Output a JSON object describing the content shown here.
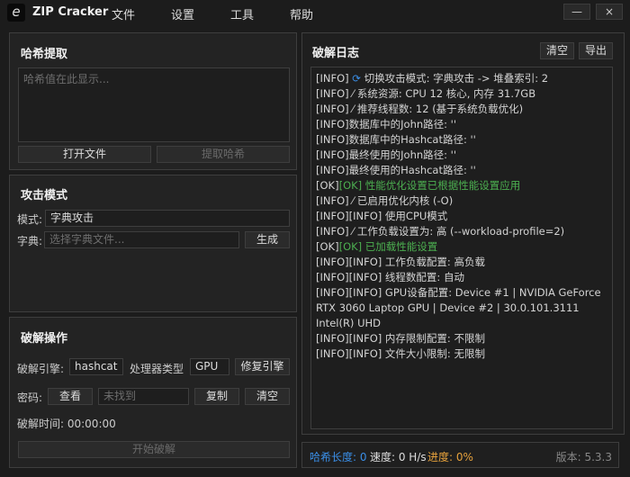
{
  "app": {
    "title": "ZIP Cracker",
    "logo": "e",
    "menu": [
      "文件",
      "设置",
      "工具",
      "帮助"
    ],
    "minimize": "—",
    "close": "×"
  },
  "hash": {
    "title": "哈希提取",
    "placeholder": "哈希值在此显示...",
    "open": "打开文件",
    "extract": "提取哈希"
  },
  "attack": {
    "title": "攻击模式",
    "mode_label": "模式:",
    "mode_value": "字典攻击",
    "dict_label": "字典:",
    "dict_placeholder": "选择字典文件...",
    "generate": "生成"
  },
  "crack": {
    "title": "破解操作",
    "engine_label": "破解引擎:",
    "engine_value": "hashcat",
    "proc_label": "处理器类型",
    "proc_value": "GPU",
    "repair": "修复引擎",
    "pwd_label": "密码:",
    "view": "查看",
    "pwd_value": "未找到",
    "copy": "复制",
    "clear": "清空",
    "time": "破解时间: 00:00:00",
    "start": "开始破解"
  },
  "log": {
    "title": "破解日志",
    "clear": "清空",
    "export": "导出",
    "lines": [
      {
        "prefix": "[INFO]",
        "icon": "refresh-icon",
        "text": "切换攻击模式: 字典攻击 -> 堆叠索引: 2"
      },
      {
        "prefix": "[INFO]",
        "icon": "wrench-icon",
        "text": "系统资源: CPU 12 核心, 内存 31.7GB"
      },
      {
        "prefix": "[INFO]",
        "icon": "wrench-icon",
        "text": "推荐线程数: 12 (基于系统负载优化)"
      },
      {
        "prefix": "[INFO]",
        "text": "数据库中的John路径: ''"
      },
      {
        "prefix": "[INFO]",
        "text": "数据库中的Hashcat路径: ''"
      },
      {
        "prefix": "[INFO]",
        "text": "最终使用的John路径: ''"
      },
      {
        "prefix": "[INFO]",
        "text": "最终使用的Hashcat路径: ''"
      },
      {
        "prefix": "[OK]",
        "ok": true,
        "text": "[OK] 性能优化设置已根据性能设置应用"
      },
      {
        "prefix": "[INFO]",
        "icon": "wrench-icon",
        "text": "已启用优化内核 (-O)"
      },
      {
        "prefix": "[INFO]",
        "text": "[INFO] 使用CPU模式"
      },
      {
        "prefix": "[INFO]",
        "icon": "wrench-icon",
        "text": "工作负载设置为: 高 (--workload-profile=2)"
      },
      {
        "prefix": "[OK]",
        "ok": true,
        "text": "[OK] 已加载性能设置"
      },
      {
        "prefix": "[INFO]",
        "text": "[INFO] 工作负载配置: 高负载"
      },
      {
        "prefix": "[INFO]",
        "text": "[INFO] 线程数配置: 自动"
      },
      {
        "prefix": "[INFO]",
        "text": "[INFO] GPU设备配置: Device #1 | NVIDIA GeForce RTX 3060 Laptop GPU | Device #2 | 30.0.101.3111 Intel(R) UHD"
      },
      {
        "prefix": "[INFO]",
        "text": "[INFO] 内存限制配置: 不限制"
      },
      {
        "prefix": "[INFO]",
        "text": "[INFO] 文件大小限制: 无限制"
      }
    ]
  },
  "status": {
    "hash_len": "哈希长度: 0",
    "speed": "速度: 0 H/s",
    "progress": "进度: 0%",
    "version": "版本: 5.3.3"
  },
  "colors": {
    "accent_blue": "#3a8ee6",
    "progress_orange": "#e6a23c",
    "ok_green": "#4caf50"
  }
}
